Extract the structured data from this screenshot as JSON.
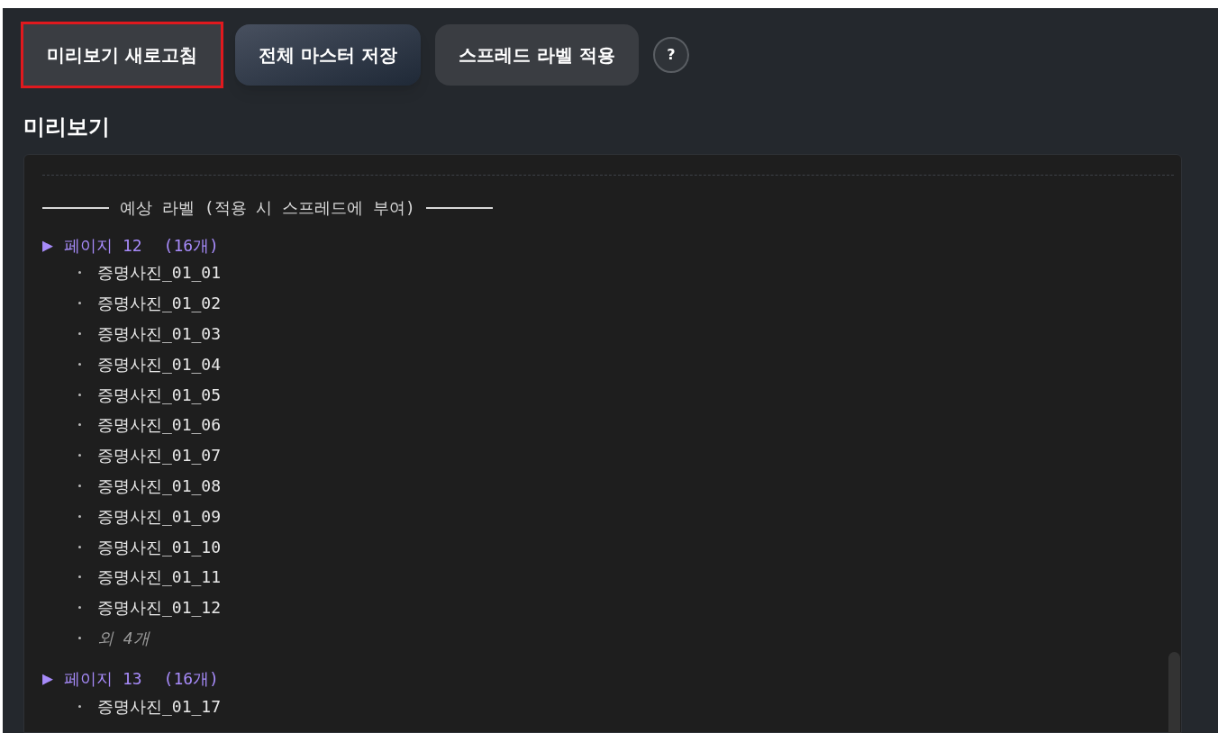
{
  "toolbar": {
    "buttons": [
      {
        "label": "미리보기 새로고침",
        "kind": "plain",
        "focused": true
      },
      {
        "label": "전체 마스터 저장",
        "kind": "gradient",
        "focused": false
      },
      {
        "label": "스프레드 라벨 적용",
        "kind": "plain",
        "focused": false
      }
    ],
    "help": "?"
  },
  "heading": "미리보기",
  "preview": {
    "section_title": "예상 라벨 (적용 시 스프레드에 부여)",
    "pages": [
      {
        "marker": "▶",
        "title": "페이지 12",
        "count": "(16개)",
        "items": [
          {
            "kind": "label",
            "text": "증명사진_01_01"
          },
          {
            "kind": "label",
            "text": "증명사진_01_02"
          },
          {
            "kind": "label",
            "text": "증명사진_01_03"
          },
          {
            "kind": "label",
            "text": "증명사진_01_04"
          },
          {
            "kind": "label",
            "text": "증명사진_01_05"
          },
          {
            "kind": "label",
            "text": "증명사진_01_06"
          },
          {
            "kind": "label",
            "text": "증명사진_01_07"
          },
          {
            "kind": "label",
            "text": "증명사진_01_08"
          },
          {
            "kind": "label",
            "text": "증명사진_01_09"
          },
          {
            "kind": "label",
            "text": "증명사진_01_10"
          },
          {
            "kind": "label",
            "text": "증명사진_01_11"
          },
          {
            "kind": "label",
            "text": "증명사진_01_12"
          },
          {
            "kind": "more",
            "text": "외 4개"
          }
        ]
      },
      {
        "marker": "▶",
        "title": "페이지 13",
        "count": "(16개)",
        "items": [
          {
            "kind": "label",
            "text": "증명사진_01_17"
          }
        ]
      }
    ]
  }
}
